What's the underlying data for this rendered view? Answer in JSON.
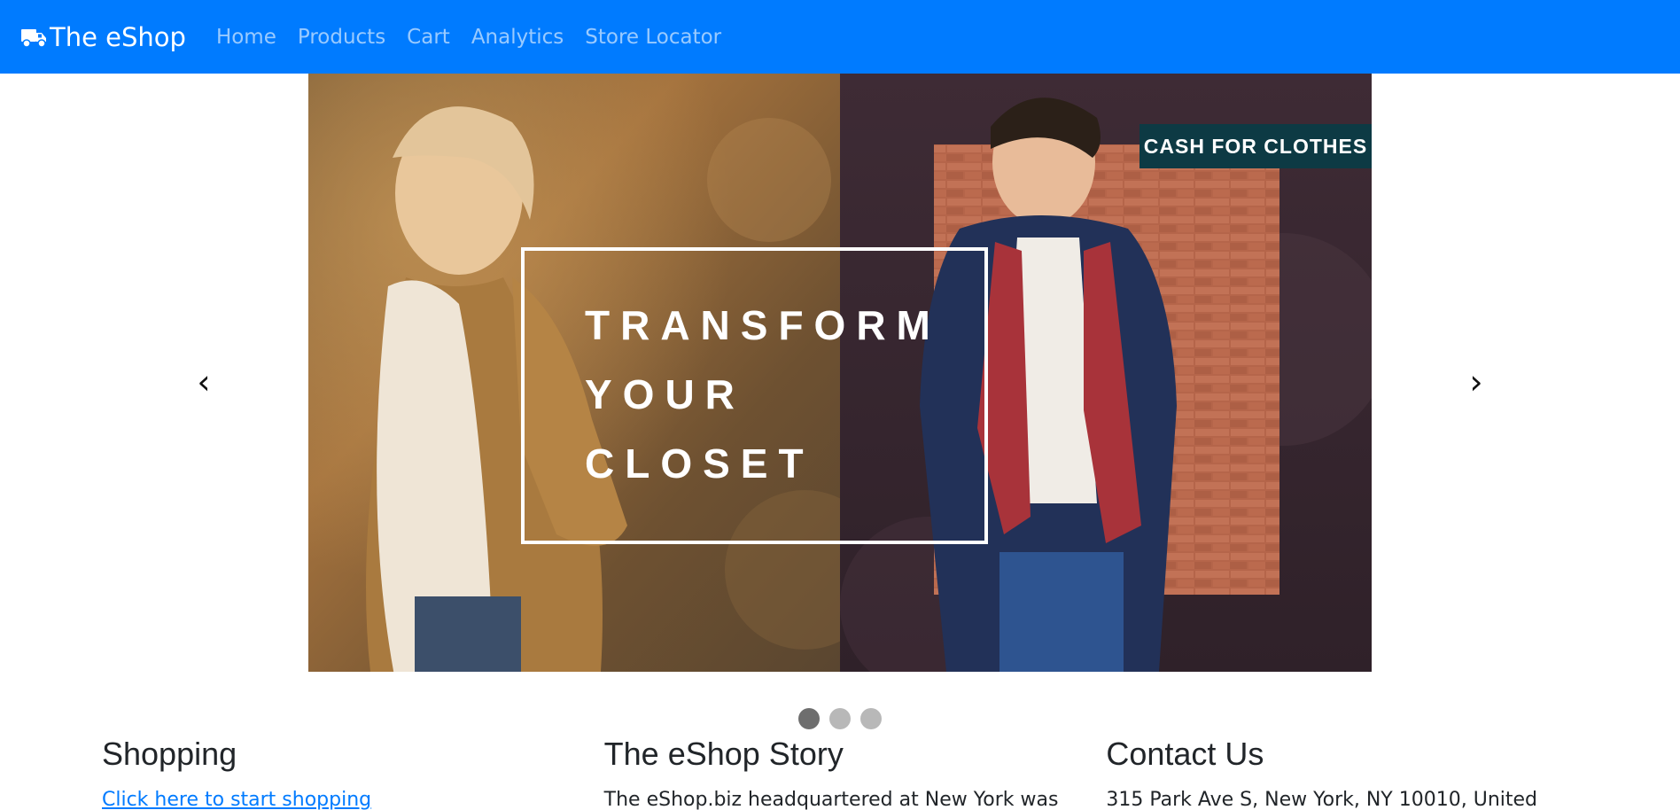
{
  "navbar": {
    "brand": "The eShop",
    "links": [
      "Home",
      "Products",
      "Cart",
      "Analytics",
      "Store Locator"
    ]
  },
  "carousel": {
    "slide_text_lines": [
      "TRANSFORM",
      "YOUR",
      "CLOSET"
    ],
    "badge": "CASH FOR CLOTHES",
    "prev_glyph": "‹",
    "next_glyph": "›",
    "indicator_count": 3,
    "active_index": 0
  },
  "sections": {
    "shopping": {
      "title": "Shopping",
      "link": "Click here to start shopping"
    },
    "story": {
      "title": "The eShop Story",
      "text": "The eShop.biz headquartered at New York was"
    },
    "contact": {
      "title": "Contact Us",
      "text": "315 Park Ave S, New York, NY 10010, United"
    }
  },
  "colors": {
    "navbar_bg": "#007bff",
    "badge_bg": "#0d3a44"
  }
}
